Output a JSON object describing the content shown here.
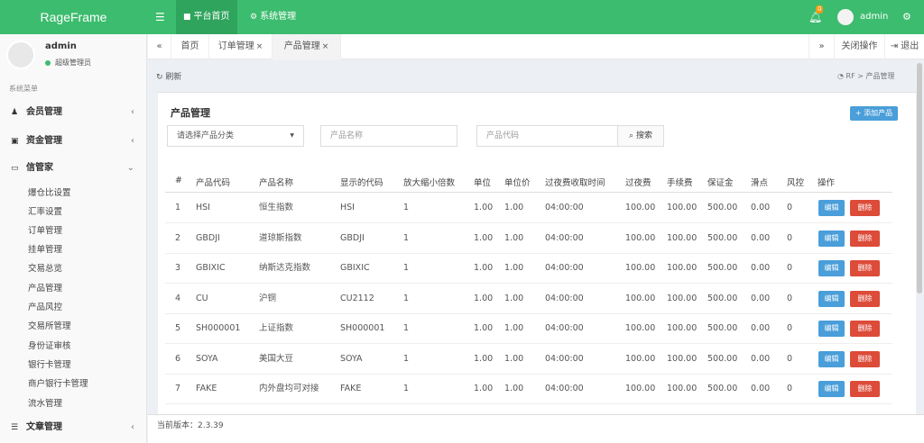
{
  "header": {
    "logo": "RageFrame",
    "nav": [
      {
        "icon": "bookmark-icon",
        "label": "平台首页"
      },
      {
        "icon": "cogs-icon",
        "label": "系统管理"
      }
    ],
    "notification_count": "0",
    "user": "admin"
  },
  "sidebar": {
    "user_name": "admin",
    "user_role": "超级管理员",
    "section_label": "系统菜单",
    "menus": [
      {
        "icon": "user-icon",
        "label": "会员管理",
        "arrow": "‹"
      },
      {
        "icon": "money-icon",
        "label": "资金管理",
        "arrow": "‹"
      },
      {
        "icon": "message-icon",
        "label": "信管家",
        "arrow": "⌄"
      }
    ],
    "submenu": [
      "爆仓比设置",
      "汇率设置",
      "订单管理",
      "挂单管理",
      "交易总览",
      "产品管理",
      "产品风控",
      "交易所管理",
      "身份证审核",
      "银行卡管理",
      "商户银行卡管理",
      "流水管理"
    ],
    "bottom_menu": {
      "icon": "list-icon",
      "label": "文章管理",
      "arrow": "‹"
    }
  },
  "tabsbar": {
    "back": "«",
    "tabs": [
      {
        "label": "首页",
        "closable": false
      },
      {
        "label": "订单管理",
        "closable": true
      },
      {
        "label": "产品管理",
        "closable": true,
        "active": true
      }
    ],
    "close": "×",
    "forward": "»",
    "close_ops": "关闭操作",
    "logout": "退出"
  },
  "content": {
    "refresh": "刷新",
    "breadcrumb_home": "RF",
    "breadcrumb_current": "产品管理",
    "title": "产品管理",
    "add_button": "+ 添加产品",
    "category_placeholder": "请选择产品分类",
    "name_placeholder": "产品名称",
    "code_placeholder": "产品代码",
    "search_label": "搜索",
    "columns": [
      "#",
      "产品代码",
      "产品名称",
      "显示的代码",
      "放大缩小倍数",
      "单位",
      "单位价",
      "过夜费收取时间",
      "过夜费",
      "手续费",
      "保证金",
      "滑点",
      "风控",
      "操作"
    ],
    "rows": [
      [
        "1",
        "HSI",
        "恒生指数",
        "HSI",
        "1",
        "1.00",
        "1.00",
        "04:00:00",
        "100.00",
        "100.00",
        "500.00",
        "0.00",
        "0"
      ],
      [
        "2",
        "GBDJI",
        "道琼斯指数",
        "GBDJI",
        "1",
        "1.00",
        "1.00",
        "04:00:00",
        "100.00",
        "100.00",
        "500.00",
        "0.00",
        "0"
      ],
      [
        "3",
        "GBIXIC",
        "纳斯达克指数",
        "GBIXIC",
        "1",
        "1.00",
        "1.00",
        "04:00:00",
        "100.00",
        "100.00",
        "500.00",
        "0.00",
        "0"
      ],
      [
        "4",
        "CU",
        "沪铜",
        "CU2112",
        "1",
        "1.00",
        "1.00",
        "04:00:00",
        "100.00",
        "100.00",
        "500.00",
        "0.00",
        "0"
      ],
      [
        "5",
        "SH000001",
        "上证指数",
        "SH000001",
        "1",
        "1.00",
        "1.00",
        "04:00:00",
        "100.00",
        "100.00",
        "500.00",
        "0.00",
        "0"
      ],
      [
        "6",
        "SOYA",
        "美国大豆",
        "SOYA",
        "1",
        "1.00",
        "1.00",
        "04:00:00",
        "100.00",
        "100.00",
        "500.00",
        "0.00",
        "0"
      ],
      [
        "7",
        "FAKE",
        "内外盘均可对接",
        "FAKE",
        "1",
        "1.00",
        "1.00",
        "04:00:00",
        "100.00",
        "100.00",
        "500.00",
        "0.00",
        "0"
      ]
    ],
    "edit_label": "编辑",
    "delete_label": "删除"
  },
  "footer": {
    "version": "当前版本：2.3.39"
  },
  "colors": {
    "brand_green": "#3cbc6e",
    "edit_blue": "#4a9ed9",
    "delete_red": "#dd4b39"
  }
}
